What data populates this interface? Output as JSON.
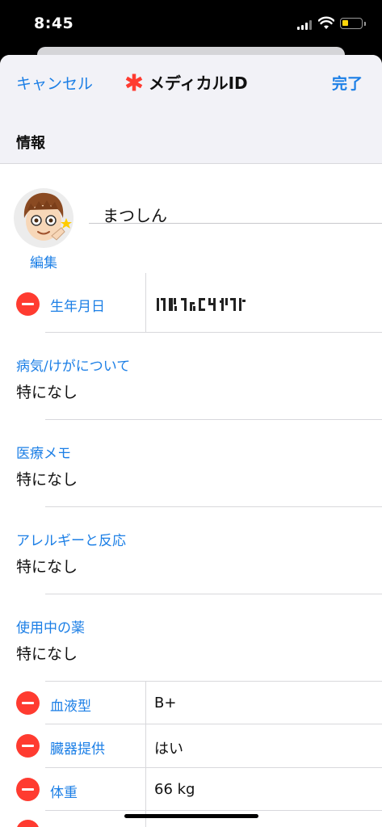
{
  "status_bar": {
    "time": "8:45"
  },
  "nav": {
    "cancel_label": "キャンセル",
    "title": "メディカルID",
    "done_label": "完了"
  },
  "section": {
    "title": "情報"
  },
  "profile": {
    "name": "まつしん",
    "edit_label": "編集"
  },
  "birthday": {
    "label": "生年月日"
  },
  "fields": [
    {
      "label": "病気/けがについて",
      "value": "特になし"
    },
    {
      "label": "医療メモ",
      "value": "特になし"
    },
    {
      "label": "アレルギーと反応",
      "value": "特になし"
    },
    {
      "label": "使用中の薬",
      "value": "特になし"
    }
  ],
  "rows": [
    {
      "label": "血液型",
      "value": "B+"
    },
    {
      "label": "臓器提供",
      "value": "はい"
    },
    {
      "label": "体重",
      "value": "66 kg"
    }
  ],
  "colors": {
    "accent": "#1c7fe6",
    "delete": "#ff3b30",
    "battery": "#ffd60a"
  }
}
